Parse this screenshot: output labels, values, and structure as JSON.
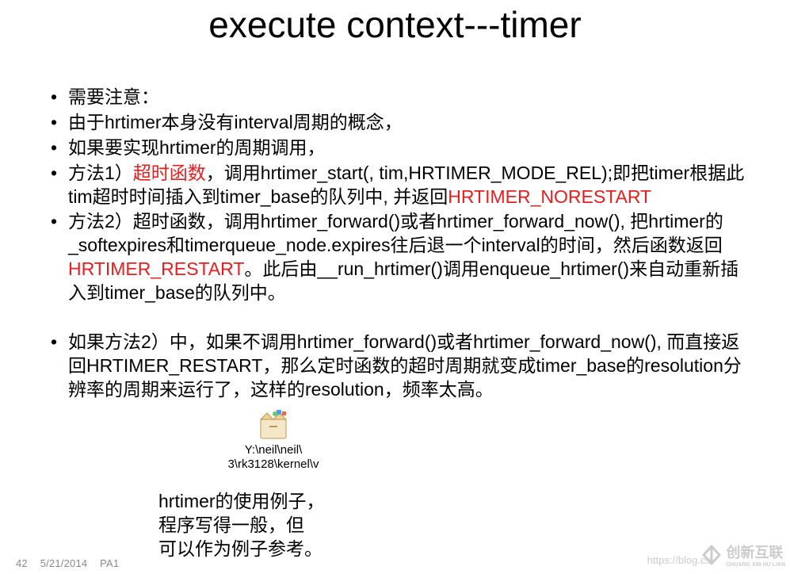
{
  "title": "execute context---timer",
  "bullets": {
    "b1": "需要注意：",
    "b2": "由于hrtimer本身没有interval周期的概念，",
    "b3": "如果要实现hrtimer的周期调用，",
    "b4_pre": "方法1）",
    "b4_red1": "超时函数",
    "b4_mid": "，调用hrtimer_start(, tim,HRTIMER_MODE_REL);即把timer根据此tim超时时间插入到timer_base的队列中, 并返回",
    "b4_red2": "HRTIMER_NORESTART",
    "b5_pre": "方法2）超时函数，调用hrtimer_forward()或者hrtimer_forward_now(), 把hrtimer的_softexpires和timerqueue_node.expires往后退一个interval的时间，然后函数返回",
    "b5_red": "HRTIMER_RESTART",
    "b5_post": "。此后由__run_hrtimer()调用enqueue_hrtimer()来自动重新插入到timer_base的队列中。",
    "b6": "如果方法2）中，如果不调用hrtimer_forward()或者hrtimer_forward_now(), 而直接返回HRTIMER_RESTART，那么定时函数的超时周期就变成timer_base的resolution分辨率的周期来运行了，这样的resolution，频率太高。"
  },
  "embed": {
    "line1": "Y:\\neil\\neil\\",
    "line2": "3\\rk3128\\kernel\\v"
  },
  "caption": {
    "l1": "hrtimer的使用例子，",
    "l2": "程序写得一般，但",
    "l3": "可以作为例子参考。"
  },
  "footer": {
    "page": "42",
    "date": "5/21/2014",
    "tag": "PA1"
  },
  "watermark": {
    "url": "https://blog.cs",
    "brand": "创新互联",
    "brand_sub1": "CHUANG XIN HU LIAN"
  }
}
